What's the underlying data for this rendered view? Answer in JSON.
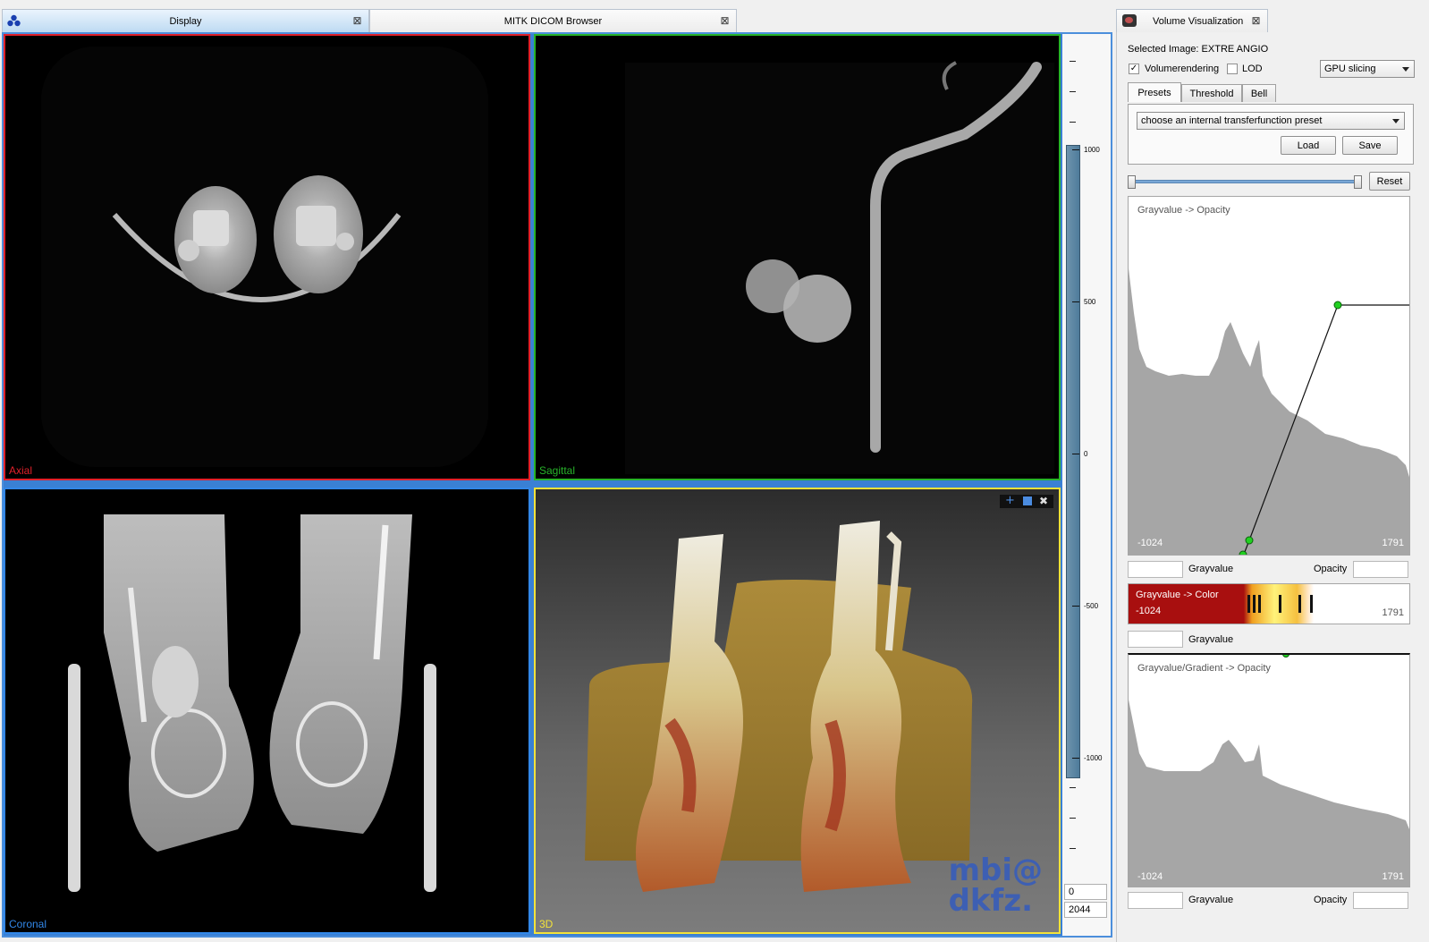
{
  "tabs": [
    {
      "label": "Display",
      "active": true
    },
    {
      "label": "MITK DICOM Browser",
      "active": false
    }
  ],
  "views": {
    "axial": {
      "label": "Axial",
      "color": "#e0202a"
    },
    "sagittal": {
      "label": "Sagittal",
      "color": "#27b42a"
    },
    "coronal": {
      "label": "Coronal",
      "color": "#3287e8"
    },
    "view3d": {
      "label": "3D",
      "color": "#f3e23a"
    }
  },
  "view3d_watermark": {
    "line1": "mbi@",
    "line2": "dkfz."
  },
  "levelwindow": {
    "labels": [
      "1000",
      "500",
      "0",
      "-500",
      "-1000"
    ],
    "level": "0",
    "window": "2044"
  },
  "panel": {
    "title": "Volume Visualization",
    "selected_image": "Selected Image: EXTRE ANGIO",
    "volumerendering": {
      "label": "Volumerendering",
      "checked": true
    },
    "lod": {
      "label": "LOD",
      "checked": false
    },
    "render_mode": "GPU slicing",
    "subtabs": [
      {
        "label": "Presets",
        "active": true
      },
      {
        "label": "Threshold",
        "active": false
      },
      {
        "label": "Bell",
        "active": false
      }
    ],
    "preset_placeholder": "choose an internal transferfunction preset",
    "load_label": "Load",
    "save_label": "Save",
    "reset_label": "Reset",
    "opacity_tf": {
      "title": "Grayvalue -> Opacity",
      "min": "-1024",
      "max": "1791",
      "gray_label": "Grayvalue",
      "opacity_label": "Opacity"
    },
    "color_tf": {
      "title": "Grayvalue -> Color",
      "min": "-1024",
      "max": "1791",
      "gray_label": "Grayvalue"
    },
    "gradient_tf": {
      "title": "Grayvalue/Gradient -> Opacity",
      "min": "-1024",
      "max": "1791",
      "gray_label": "Grayvalue",
      "opacity_label": "Opacity"
    }
  }
}
